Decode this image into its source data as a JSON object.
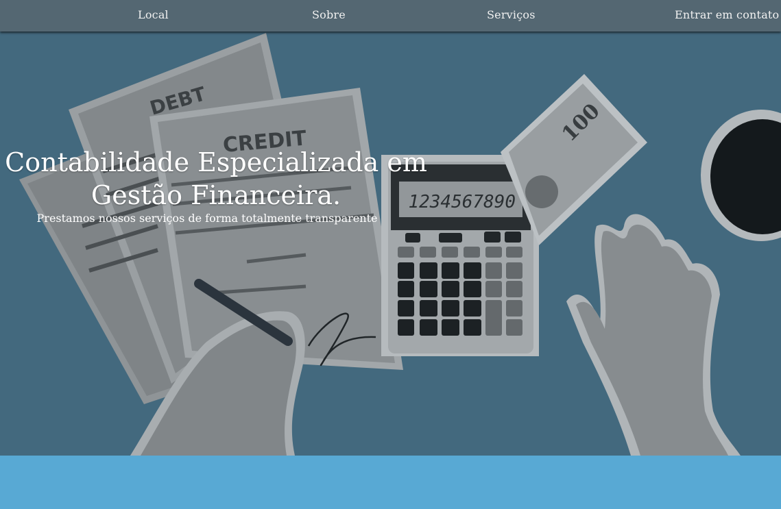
{
  "nav": {
    "items": [
      {
        "label": "Local"
      },
      {
        "label": "Sobre"
      },
      {
        "label": "Serviços"
      },
      {
        "label": "Entrar em contato"
      }
    ]
  },
  "hero": {
    "title_line1": "Contabilidade Especializada em",
    "title_line2": "Gestão Financeira.",
    "subtitle": "Prestamos nossos serviços de forma totalmente transparente",
    "image": {
      "debt_label": "DEBT",
      "credit_label": "CREDIT",
      "calculator_display": "1234567890",
      "bill_value": "100"
    }
  },
  "colors": {
    "nav_bg": "#546772",
    "hero_bg": "#466b80",
    "band": "#58a9d4"
  }
}
